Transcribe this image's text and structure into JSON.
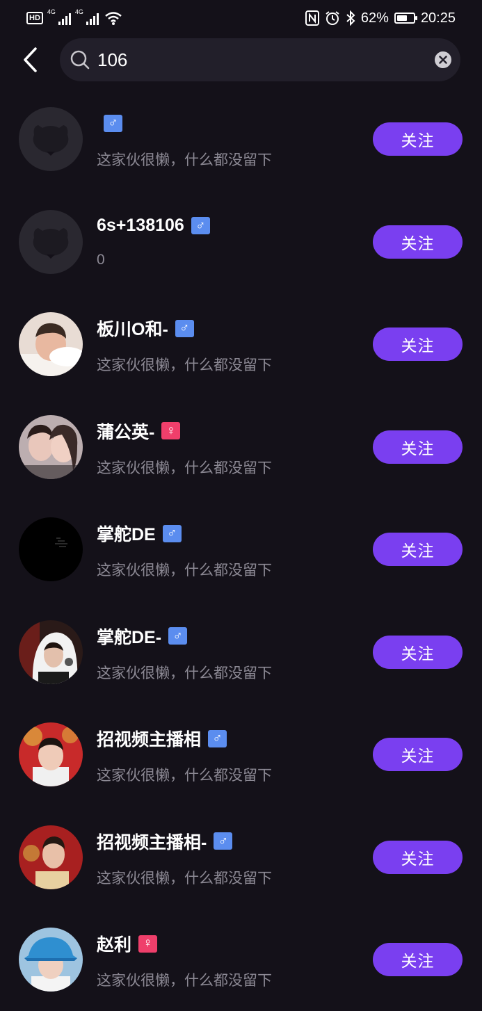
{
  "status_bar": {
    "hd_label": "HD",
    "signal1_label": "4G",
    "signal2_label": "4G",
    "battery_percent": "62%",
    "battery_level": 0.62,
    "time": "20:25"
  },
  "search": {
    "query": "106"
  },
  "colors": {
    "accent": "#7a3ff0",
    "male_badge": "#5b8def",
    "female_badge": "#ef3f6b",
    "background": "#141119"
  },
  "results": [
    {
      "name": "",
      "gender_symbol": "♂",
      "gender": "male",
      "bio": "这家伙很懒，什么都没留下",
      "follow_label": "关注",
      "avatar": "default-cow"
    },
    {
      "name": "6s+138106",
      "gender_symbol": "♂",
      "gender": "male",
      "bio": "0",
      "follow_label": "关注",
      "avatar": "default-cow"
    },
    {
      "name": "板川O和-",
      "gender_symbol": "♂",
      "gender": "male",
      "bio": "这家伙很懒，什么都没留下",
      "follow_label": "关注",
      "avatar": "photo-boy-pillow"
    },
    {
      "name": "蒲公英-",
      "gender_symbol": "♀",
      "gender": "female",
      "bio": "这家伙很懒，什么都没留下",
      "follow_label": "关注",
      "avatar": "photo-couple"
    },
    {
      "name": "掌舵DE",
      "gender_symbol": "♂",
      "gender": "male",
      "bio": "这家伙很懒，什么都没留下",
      "follow_label": "关注",
      "avatar": "black-text"
    },
    {
      "name": "掌舵DE-",
      "gender_symbol": "♂",
      "gender": "male",
      "bio": "这家伙很懒，什么都没留下",
      "follow_label": "关注",
      "avatar": "photo-singer"
    },
    {
      "name": "招视频主播相",
      "gender_symbol": "♂",
      "gender": "male",
      "bio": "这家伙很懒，什么都没留下",
      "follow_label": "关注",
      "avatar": "photo-boy-red"
    },
    {
      "name": "招视频主播相-",
      "gender_symbol": "♂",
      "gender": "male",
      "bio": "这家伙很懒，什么都没留下",
      "follow_label": "关注",
      "avatar": "photo-boy-red-2"
    },
    {
      "name": "赵利",
      "gender_symbol": "♀",
      "gender": "female",
      "bio": "这家伙很懒，什么都没留下",
      "follow_label": "关注",
      "avatar": "photo-boy-hat"
    }
  ]
}
